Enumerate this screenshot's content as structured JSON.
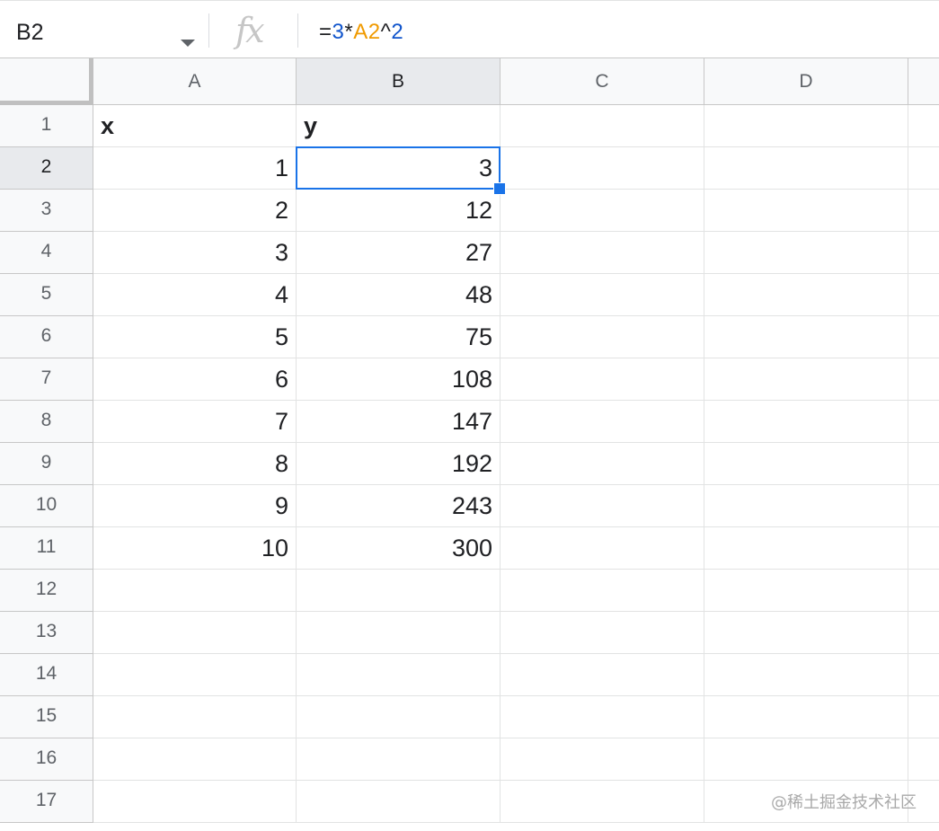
{
  "formula_bar": {
    "name_box": "B2",
    "fx_label": "fx",
    "formula_tokens": [
      {
        "text": "=",
        "kind": "op"
      },
      {
        "text": "3",
        "kind": "num"
      },
      {
        "text": "*",
        "kind": "op"
      },
      {
        "text": "A2",
        "kind": "ref"
      },
      {
        "text": "^",
        "kind": "op"
      },
      {
        "text": "2",
        "kind": "num"
      }
    ]
  },
  "columns": [
    "A",
    "B",
    "C",
    "D"
  ],
  "selected_column": "B",
  "rows": [
    "1",
    "2",
    "3",
    "4",
    "5",
    "6",
    "7",
    "8",
    "9",
    "10",
    "11",
    "12",
    "13",
    "14",
    "15",
    "16",
    "17"
  ],
  "selected_row": "2",
  "cells": {
    "header": [
      "x",
      "y"
    ],
    "x_values": [
      "1",
      "2",
      "3",
      "4",
      "5",
      "6",
      "7",
      "8",
      "9",
      "10"
    ],
    "y_values": [
      "3",
      "12",
      "27",
      "48",
      "75",
      "108",
      "147",
      "192",
      "243",
      "300"
    ]
  },
  "active_cell": "B2",
  "watermark": "@稀土掘金技术社区",
  "colors": {
    "selection": "#1a73e8",
    "formula_number": "#1155cc",
    "formula_reference": "#f09a00"
  }
}
